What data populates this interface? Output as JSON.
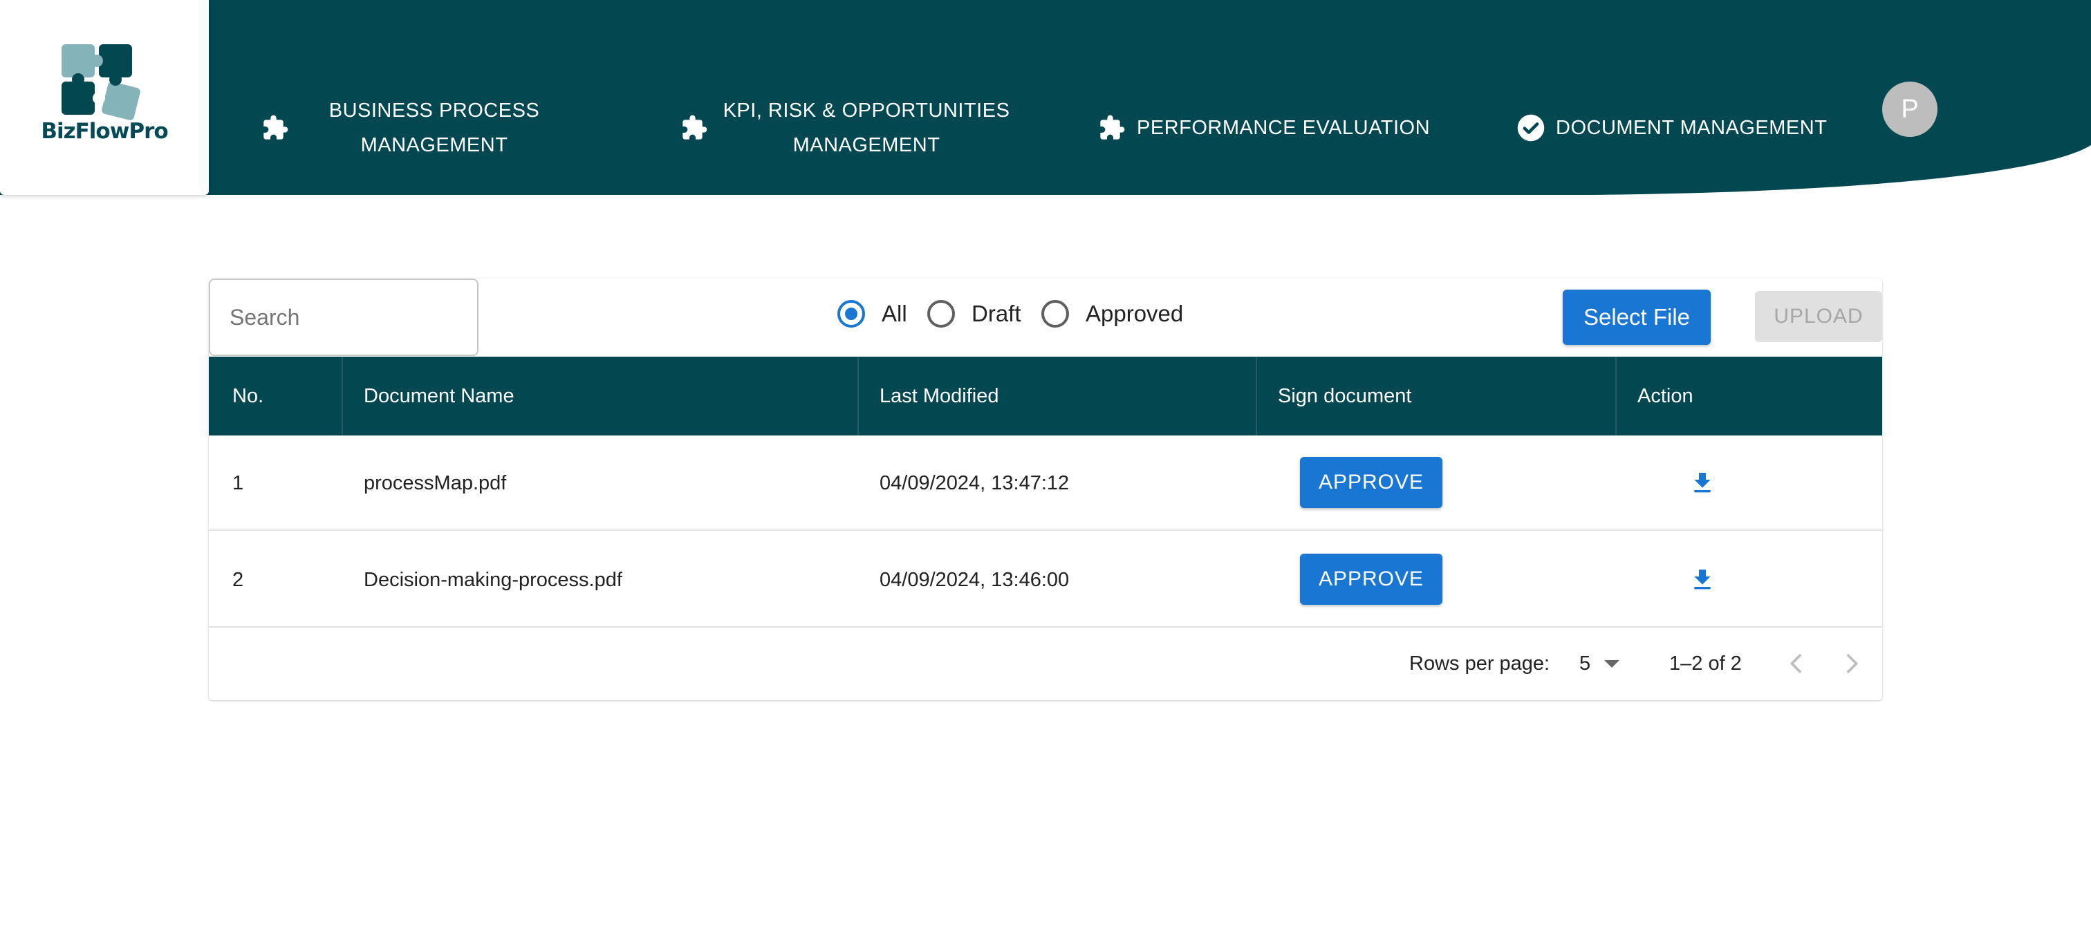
{
  "brand": {
    "name": "BizFlowPro",
    "primary_color": "#034750",
    "accent_color": "#1976d2"
  },
  "nav": {
    "items": [
      {
        "label": "BUSINESS PROCESS MANAGEMENT",
        "icon": "puzzle-icon",
        "active": false
      },
      {
        "label": "KPI, RISK & OPPORTUNITIES MANAGEMENT",
        "icon": "puzzle-icon",
        "active": false
      },
      {
        "label": "PERFORMANCE EVALUATION",
        "icon": "puzzle-icon",
        "active": false
      },
      {
        "label": "DOCUMENT MANAGEMENT",
        "icon": "check-circle-icon",
        "active": true
      }
    ],
    "avatar_initial": "P"
  },
  "toolbar": {
    "search_placeholder": "Search",
    "filters": [
      {
        "label": "All",
        "checked": true
      },
      {
        "label": "Draft",
        "checked": false
      },
      {
        "label": "Approved",
        "checked": false
      }
    ],
    "select_file_label": "Select File",
    "upload_label": "UPLOAD"
  },
  "table": {
    "headers": [
      "No.",
      "Document Name",
      "Last Modified",
      "Sign document",
      "Action"
    ],
    "rows": [
      {
        "no": "1",
        "name": "processMap.pdf",
        "modified": "04/09/2024, 13:47:12",
        "sign_label": "APPROVE",
        "action_icon": "download-icon"
      },
      {
        "no": "2",
        "name": "Decision-making-process.pdf",
        "modified": "04/09/2024, 13:46:00",
        "sign_label": "APPROVE",
        "action_icon": "download-icon"
      }
    ]
  },
  "pagination": {
    "rows_per_page_label": "Rows per page:",
    "rows_per_page_value": "5",
    "range": "1–2 of 2"
  }
}
